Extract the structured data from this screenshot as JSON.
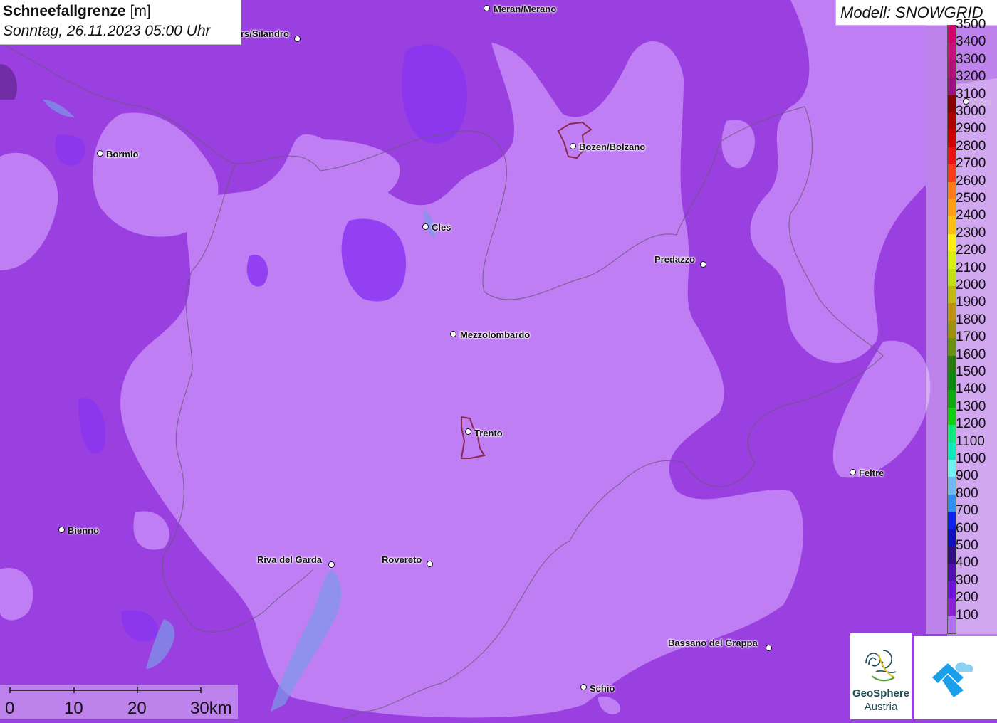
{
  "title": {
    "parameter": "Schneefallgrenze",
    "unit": "[m]",
    "datetime": "Sonntag, 26.11.2023 05:00 Uhr"
  },
  "model": "Modell: SNOWGRID",
  "legend": {
    "items": [
      {
        "label": "3500",
        "color": "#d4006e"
      },
      {
        "label": "3400",
        "color": "#c8107a"
      },
      {
        "label": "3300",
        "color": "#b4107a"
      },
      {
        "label": "3200",
        "color": "#9a1080"
      },
      {
        "label": "3100",
        "color": "#8a0000"
      },
      {
        "label": "3000",
        "color": "#b00000"
      },
      {
        "label": "2900",
        "color": "#d00000"
      },
      {
        "label": "2800",
        "color": "#ee1010"
      },
      {
        "label": "2700",
        "color": "#ff3a1a"
      },
      {
        "label": "2600",
        "color": "#ff7a1a"
      },
      {
        "label": "2500",
        "color": "#ff9e10"
      },
      {
        "label": "2400",
        "color": "#ffbf10"
      },
      {
        "label": "2300",
        "color": "#ffef10"
      },
      {
        "label": "2200",
        "color": "#d8f010"
      },
      {
        "label": "2100",
        "color": "#c0e010"
      },
      {
        "label": "2000",
        "color": "#c4b810"
      },
      {
        "label": "1900",
        "color": "#c09010"
      },
      {
        "label": "1800",
        "color": "#a09010"
      },
      {
        "label": "1700",
        "color": "#6a9010"
      },
      {
        "label": "1600",
        "color": "#2a7a10"
      },
      {
        "label": "1500",
        "color": "#0a8a10"
      },
      {
        "label": "1400",
        "color": "#10a810"
      },
      {
        "label": "1300",
        "color": "#10d010"
      },
      {
        "label": "1200",
        "color": "#10e880"
      },
      {
        "label": "1100",
        "color": "#10e8c0"
      },
      {
        "label": "1000",
        "color": "#70f0f0"
      },
      {
        "label": "900",
        "color": "#70b8f0"
      },
      {
        "label": "800",
        "color": "#3090f0"
      },
      {
        "label": "700",
        "color": "#1020f0"
      },
      {
        "label": "600",
        "color": "#1010c0"
      },
      {
        "label": "500",
        "color": "#301080"
      },
      {
        "label": "400",
        "color": "#5010b0"
      },
      {
        "label": "300",
        "color": "#7010e0"
      },
      {
        "label": "200",
        "color": "#9020d8"
      },
      {
        "label": "100",
        "color": "#b070f0"
      }
    ]
  },
  "places": [
    {
      "name": "Meran/Merano"
    },
    {
      "name": "rs/Silandro"
    },
    {
      "name": "Bormio"
    },
    {
      "name": "Bozen/Bolzano"
    },
    {
      "name": "Cles"
    },
    {
      "name": "Predazzo"
    },
    {
      "name": "Mezzolombardo"
    },
    {
      "name": "Trento"
    },
    {
      "name": "Feltre"
    },
    {
      "name": "Bienno"
    },
    {
      "name": "Riva del Garda"
    },
    {
      "name": "Rovereto"
    },
    {
      "name": "Bassano del Grappa"
    },
    {
      "name": "Schio"
    },
    {
      "name": "Corti"
    }
  ],
  "scalebar": {
    "labels": [
      "0",
      "10",
      "20",
      "30km"
    ]
  },
  "logos": {
    "geosphere_line1": "GeoSphere",
    "geosphere_line2": "Austria"
  },
  "colors": {
    "zone_100": "#c07ef4",
    "zone_200": "#9a3fe0",
    "zone_300": "#8a35f0"
  }
}
